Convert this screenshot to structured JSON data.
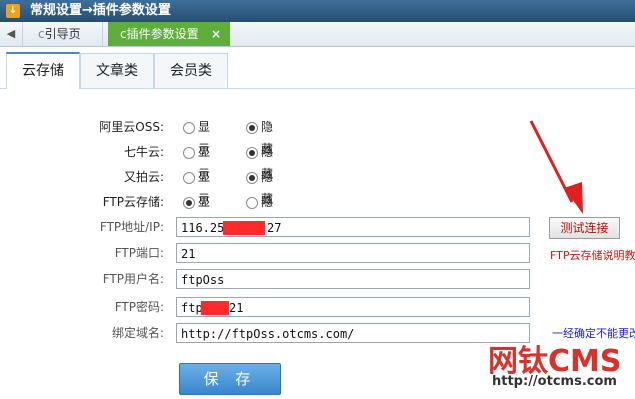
{
  "window": {
    "title": "常规设置→插件参数设置"
  },
  "page_tabs": [
    {
      "label": "引导页"
    },
    {
      "label": "插件参数设置",
      "close": "×"
    }
  ],
  "sub_tabs": [
    "云存储",
    "文章类",
    "会员类"
  ],
  "radios": [
    {
      "label": "阿里云OSS:",
      "options": [
        "显示",
        "隐藏"
      ],
      "selected": "隐藏"
    },
    {
      "label": "七牛云:",
      "options": [
        "显示",
        "隐藏"
      ],
      "selected": "隐藏"
    },
    {
      "label": "又拍云:",
      "options": [
        "显示",
        "隐藏"
      ],
      "selected": "隐藏"
    },
    {
      "label": "FTP云存储:",
      "options": [
        "显示",
        "隐藏"
      ],
      "selected": "显示"
    }
  ],
  "fields": {
    "host": {
      "label": "FTP地址/IP:",
      "value_a": "116.25",
      "value_b": "27"
    },
    "port": {
      "label": "FTP端口:",
      "value": "21"
    },
    "user": {
      "label": "FTP用户名:",
      "value": "ftpOss"
    },
    "pass": {
      "label": "FTP密码:",
      "value_a": "ftp",
      "value_b": "21"
    },
    "domain": {
      "label": "绑定域名:",
      "value": "http://ftpOss.otcms.com/"
    }
  },
  "buttons": {
    "test": "测试连接",
    "save": "保 存"
  },
  "notes": {
    "explain": "FTP云存储说明教",
    "domain_hint": "一经确定不能更改"
  },
  "watermark": {
    "brand": "网钛CMS",
    "url": "http://otcms.com"
  },
  "colors": {
    "active_tab": "#5fae3c",
    "save_button": "#3a86cc",
    "alert_red": "#e01010"
  }
}
